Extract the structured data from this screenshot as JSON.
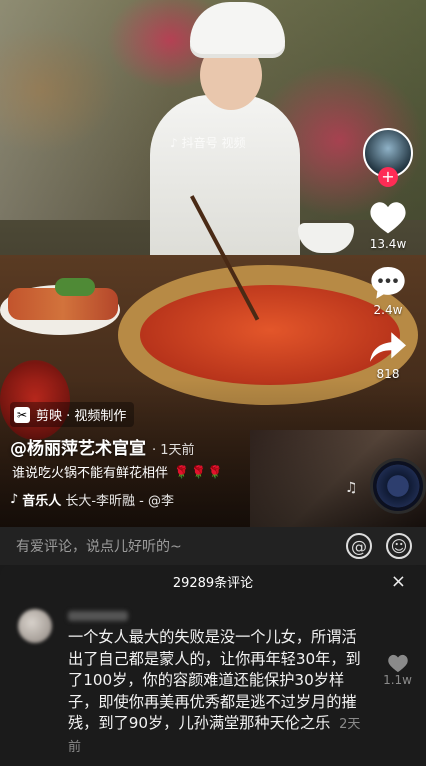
{
  "video": {
    "watermark": "抖音号 视频",
    "capcut_badge": "剪映 · 视频制作",
    "author": "@杨丽萍艺术官宣",
    "posted": "· 1天前",
    "caption": "谁说吃火锅不能有鲜花相伴",
    "caption_emoji": "🌹🌹🌹",
    "music_label": "音乐人",
    "music_text": "长大-李昕融 - @李"
  },
  "rail": {
    "follow": "+",
    "likes": "13.4w",
    "comments": "2.4w",
    "shares": "818"
  },
  "comment_bar": {
    "placeholder": "有爱评论，说点儿好听的~"
  },
  "sheet": {
    "title": "29289条评论",
    "close": "×",
    "comment": {
      "text": "一个女人最大的失败是没一个儿女，所谓活出了自己都是蒙人的，让你再年轻30年，到了100岁，你的容颜难道还能保护30岁样子，即使你再美再优秀都是逃不过岁月的摧残，到了90岁，儿孙满堂那种天伦之乐",
      "time": "2天前",
      "likes": "1.1w"
    }
  }
}
